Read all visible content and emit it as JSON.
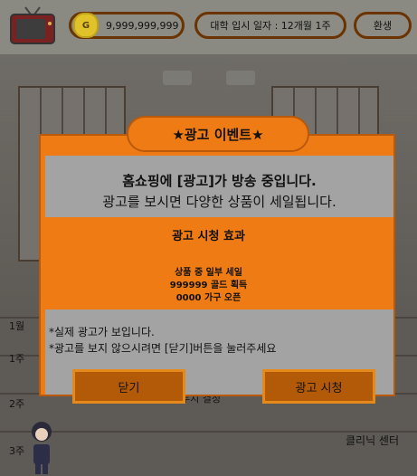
{
  "topbar": {
    "coin_label": "G",
    "gold": "9,999,999,999",
    "date": "대학 입시 일자 : 12개월 1주",
    "settings": "환생"
  },
  "scene": {
    "weeks": [
      "1월",
      "1주",
      "2주",
      "3주"
    ],
    "clinic": "클리닉 센터",
    "partial_text": "두지 결정"
  },
  "modal": {
    "title": "★광고 이벤트★",
    "message_line1": "홈쇼핑에 [광고]가 방송 중입니다.",
    "message_line2": "광고를 보시면 다양한 상품이 세일됩니다.",
    "effect_title": "광고 시청 효과",
    "effects": [
      "상품 중 일부 세일",
      "999999 골드 획득",
      "0000 가구 오픈"
    ],
    "notes": [
      "*실제 광고가 보입니다.",
      "*광고를 보지 않으시려면 [닫기]버튼을 눌러주세요"
    ],
    "close_label": "닫기",
    "watch_label": "광고 시청"
  }
}
